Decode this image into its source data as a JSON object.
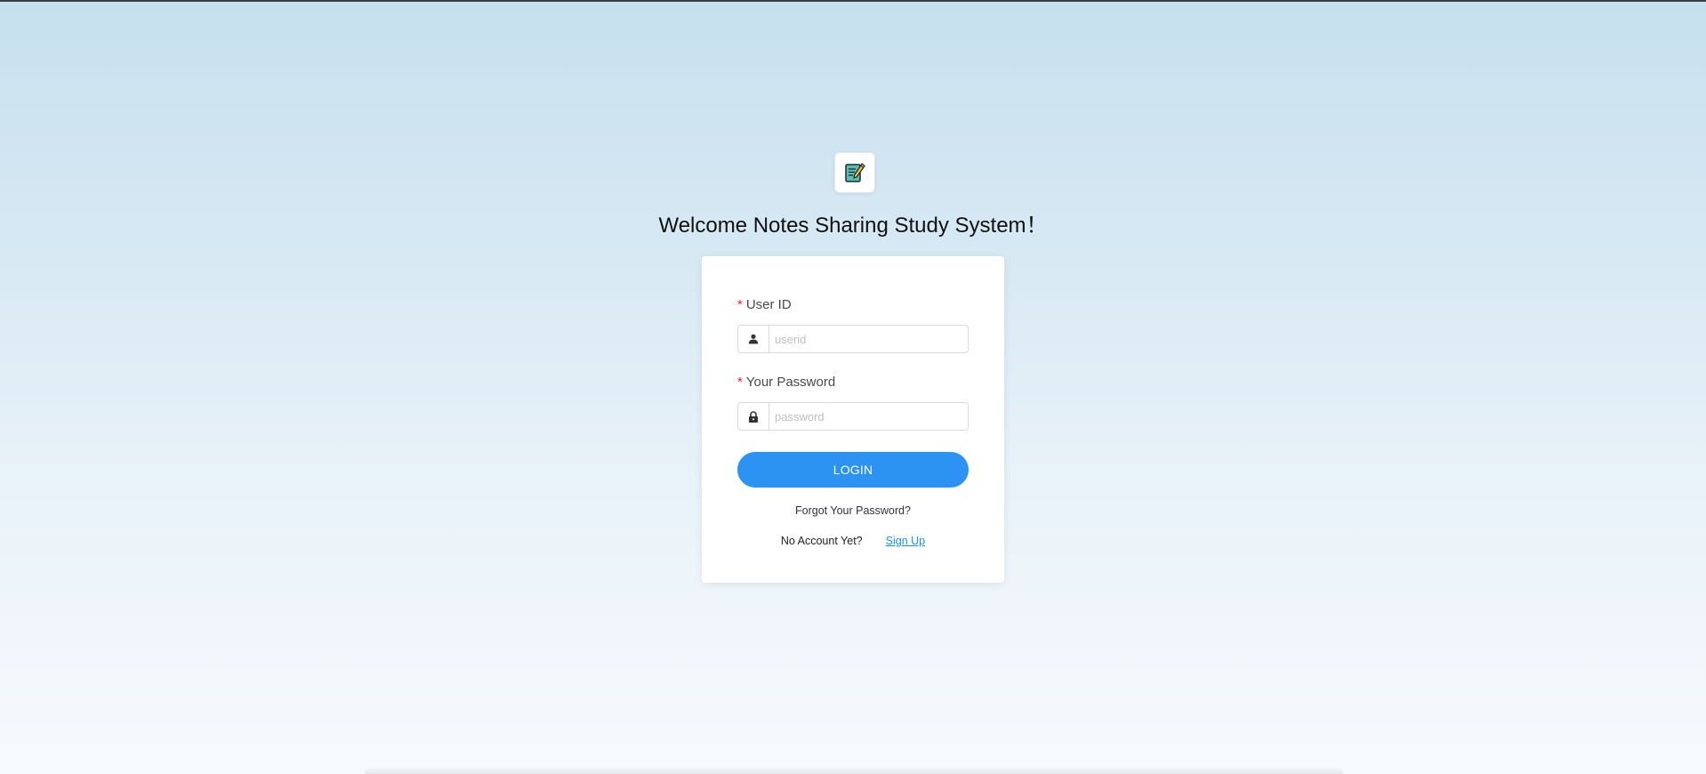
{
  "app": {
    "title": "Welcome Notes Sharing Study System！",
    "logo_icon": "notebook-pencil-icon"
  },
  "form": {
    "userid": {
      "label": "User ID",
      "required_mark": "*",
      "placeholder": "userid",
      "value": "",
      "icon": "user-icon"
    },
    "password": {
      "label": "Your Password",
      "required_mark": "*",
      "placeholder": "password",
      "value": "",
      "icon": "lock-icon"
    },
    "login_label": "LOGIN",
    "forgot_label": "Forgot Your Password?",
    "no_account_text": "No Account Yet?",
    "signup_label": "Sign Up"
  },
  "colors": {
    "primary": "#2d93f2",
    "link": "#1890ff",
    "required": "#f5222d",
    "background_top": "#c6e0ee",
    "background_bottom": "#f7fafd"
  }
}
